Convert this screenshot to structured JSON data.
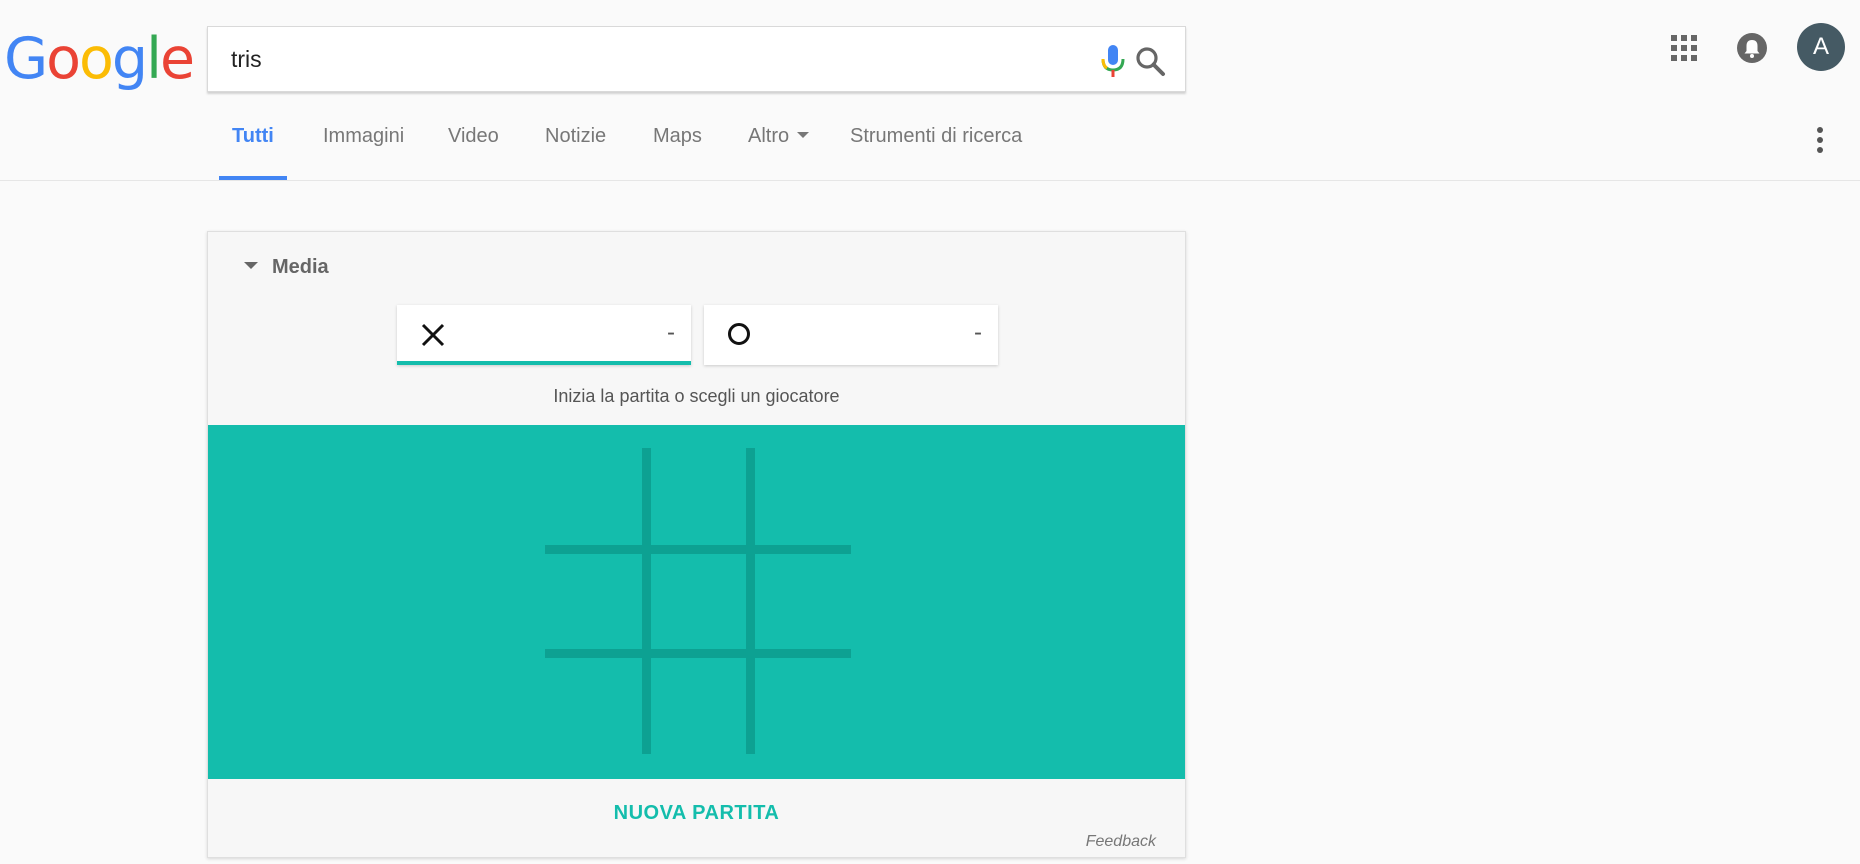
{
  "header": {
    "logo_letters": [
      {
        "char": "G",
        "color": "#4285f4"
      },
      {
        "char": "o",
        "color": "#ea4335"
      },
      {
        "char": "o",
        "color": "#fbbc05"
      },
      {
        "char": "g",
        "color": "#4285f4"
      },
      {
        "char": "l",
        "color": "#34a853"
      },
      {
        "char": "e",
        "color": "#ea4335"
      }
    ],
    "search": {
      "value": "tris",
      "icons": [
        "mic-icon",
        "search-icon"
      ]
    },
    "right_icons": [
      "apps-grid-icon",
      "notifications-bell-icon"
    ],
    "avatar_letter": "A",
    "avatar_color": "#455a64"
  },
  "tabs": {
    "items": [
      {
        "label": "Tutti",
        "active": true
      },
      {
        "label": "Immagini"
      },
      {
        "label": "Video"
      },
      {
        "label": "Notizie"
      },
      {
        "label": "Maps"
      },
      {
        "label": "Altro",
        "dropdown": true
      },
      {
        "label": "Strumenti di ricerca"
      }
    ],
    "accent_color": "#4285f4",
    "more_icon": "more-vertical-icon"
  },
  "game": {
    "difficulty_label": "Media",
    "players": [
      {
        "mark": "X",
        "score": "-",
        "selected": true
      },
      {
        "mark": "O",
        "score": "-",
        "selected": false
      }
    ],
    "hint": "Inizia la partita o scegli un giocatore",
    "board_color": "#14bdac",
    "grid_line_color": "#0da192",
    "new_game_label": "NUOVA PARTITA",
    "feedback_label": "Feedback"
  }
}
